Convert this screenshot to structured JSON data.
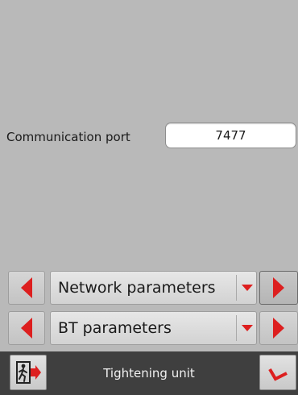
{
  "settings": {
    "port_label": "Communication port",
    "port_value": "7477"
  },
  "selectors": [
    {
      "label": "Network parameters"
    },
    {
      "label": "BT parameters"
    }
  ],
  "bottom_bar": {
    "title": "Tightening unit",
    "exit_icon": "exit-door-icon",
    "confirm_icon": "checkmark-icon"
  },
  "colors": {
    "accent_red": "#dd1f1f",
    "panel_gray": "#b9b9b9",
    "bar_dark": "#3f3f3f"
  }
}
